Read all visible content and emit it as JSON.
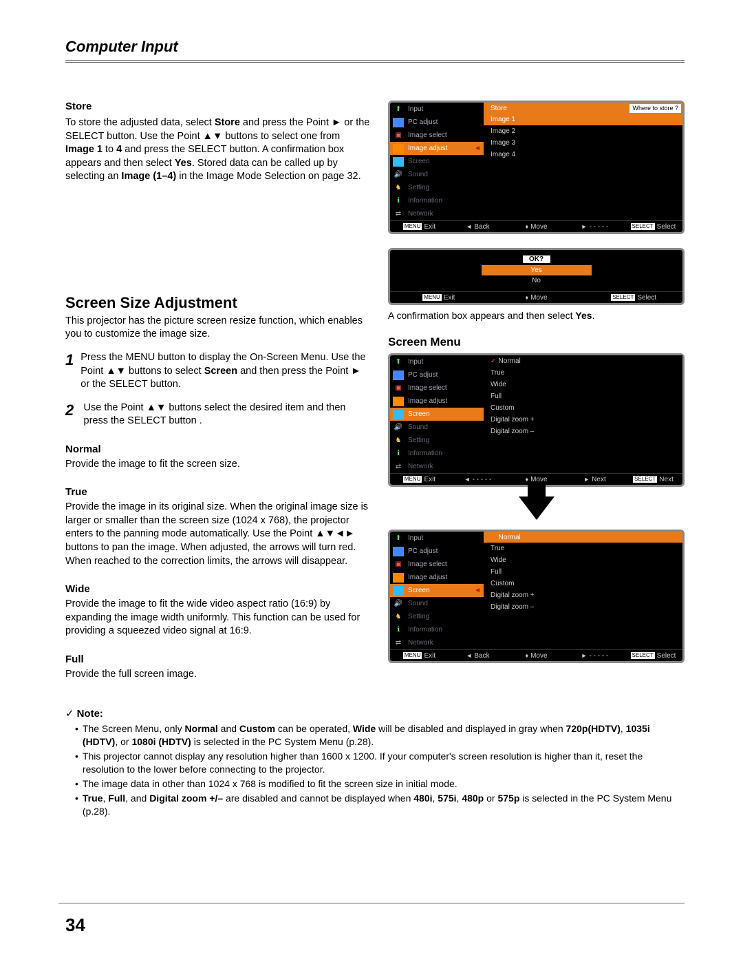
{
  "header": {
    "title": "Computer Input"
  },
  "store": {
    "heading": "Store",
    "text_parts": {
      "p1": "To store the adjusted data, select ",
      "b1": "Store",
      "p2": " and press the Point ► or the SELECT button. Use the Point ▲▼ buttons to select one from ",
      "b2": "Image 1",
      "p3": " to ",
      "b3": "4",
      "p4": " and press the SELECT button. A confirmation box appears and then select ",
      "b4": "Yes",
      "p5": ". Stored data can be called up by selecting an ",
      "b5": "Image (1–4)",
      "p6": " in the Image Mode Selection on page 32."
    }
  },
  "screen_size": {
    "heading": "Screen Size Adjustment",
    "intro": "This projector has the picture screen resize function, which enables you to customize the image size.",
    "steps": [
      {
        "num": "1",
        "pre": "Press the MENU button to display the On-Screen Menu. Use the Point ▲▼ buttons to select ",
        "bold": "Screen",
        "post": " and then press the Point ► or the SELECT button."
      },
      {
        "num": "2",
        "pre": "Use the Point ▲▼ buttons select the desired item and then press the SELECT button .",
        "bold": "",
        "post": ""
      }
    ],
    "modes": [
      {
        "title": "Normal",
        "text": "Provide the image to fit the screen size."
      },
      {
        "title": "True",
        "text": "Provide the image in its original size. When the original image size is larger or smaller than the screen size (1024 x  768), the projector enters to the panning  mode automatically. Use the Point ▲▼◄► buttons to pan the image. When adjusted, the arrows will turn red. When reached to the correction limits, the arrows will disappear."
      },
      {
        "title": "Wide",
        "text": "Provide the image to fit the wide video aspect ratio (16:9) by expanding the image width uniformly. This function can be used for providing a squeezed video signal at 16:9."
      },
      {
        "title": "Full",
        "text": "Provide the full screen image."
      }
    ]
  },
  "osd1": {
    "left": [
      "Input",
      "PC adjust",
      "Image select",
      "Image adjust",
      "Screen",
      "Sound",
      "Setting",
      "Information",
      "Network"
    ],
    "selected_idx": 3,
    "right_head": "Store",
    "right_tag": "Where to store ?",
    "right_items": [
      "Image 1",
      "Image 2",
      "Image 3",
      "Image 4"
    ],
    "footer": [
      "Exit",
      "Back",
      "Move",
      "- - - - -",
      "Select"
    ],
    "footer_btn_left": "MENU",
    "footer_btn_right": "SELECT"
  },
  "confirm": {
    "ok": "OK?",
    "yes": "Yes",
    "no": "No",
    "footer": [
      "Exit",
      "Move",
      "Select"
    ]
  },
  "caption1": {
    "p1": "A confirmation box appears and then select ",
    "b1": "Yes",
    "p2": "."
  },
  "right_heading": "Screen Menu",
  "osd2": {
    "left": [
      "Input",
      "PC adjust",
      "Image select",
      "Image adjust",
      "Screen",
      "Sound",
      "Setting",
      "Information",
      "Network"
    ],
    "selected_idx": 4,
    "right_items": [
      "Normal",
      "True",
      "Wide",
      "Full",
      "Custom",
      "Digital zoom +",
      "Digital zoom –"
    ],
    "normal_checked": true,
    "footer": [
      "Exit",
      "- - - - -",
      "Move",
      "Next",
      "Next"
    ]
  },
  "osd3": {
    "left": [
      "Input",
      "PC adjust",
      "Image select",
      "Image adjust",
      "Screen",
      "Sound",
      "Setting",
      "Information",
      "Network"
    ],
    "selected_idx": 4,
    "right_items": [
      "Normal",
      "True",
      "Wide",
      "Full",
      "Custom",
      "Digital zoom +",
      "Digital zoom –"
    ],
    "right_selected_idx": 0,
    "footer": [
      "Exit",
      "Back",
      "Move",
      "- - - - -",
      "Select"
    ]
  },
  "notes": {
    "heading": "Note:",
    "items": [
      {
        "parts": [
          "The Screen Menu, only ",
          "Normal",
          " and ",
          "Custom",
          " can be operated, ",
          "Wide",
          " will be disabled and displayed in gray when ",
          "720p(HDTV)",
          ", ",
          "1035i (HDTV)",
          ", or ",
          "1080i (HDTV)",
          " is selected in the PC System Menu (p.28)."
        ]
      },
      {
        "parts": [
          "This projector cannot display any resolution higher than 1600 x 1200. If your computer's screen resolution is higher than it, reset the resolution to the lower before connecting to the projector."
        ]
      },
      {
        "parts": [
          "The image data in other than 1024 x 768 is modified to fit the screen size in initial mode."
        ]
      },
      {
        "parts": [
          "",
          "True",
          ", ",
          "Full",
          ", and ",
          "Digital zoom +/–",
          " are disabled and cannot be displayed when ",
          "480i",
          ", ",
          "575i",
          ", ",
          "480p",
          " or ",
          "575p",
          " is selected in the PC System Menu (p.28)."
        ]
      }
    ]
  },
  "page_number": "34"
}
